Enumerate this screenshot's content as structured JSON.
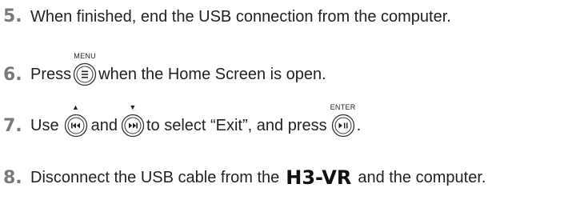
{
  "steps": [
    {
      "num": "5.",
      "text": "When finished, end the USB connection from the computer."
    },
    {
      "num": "6.",
      "pre": "Press",
      "button_caption": "MENU",
      "post": "when the Home Screen is open."
    },
    {
      "num": "7.",
      "pre": "Use",
      "mid1": "and",
      "mid2": "to select “Exit”, and press",
      "end": ".",
      "enter_caption": "ENTER"
    },
    {
      "num": "8.",
      "pre": "Disconnect the USB cable from the",
      "brand": "H3-VR",
      "post": "and the computer."
    }
  ],
  "icons": {
    "menu": "menu-button-icon",
    "prev": "rewind-button-icon",
    "next": "fast-forward-button-icon",
    "enter": "play-pause-button-icon",
    "up_marker": "up-triangle-icon",
    "down_marker": "down-triangle-icon"
  },
  "colors": {
    "step_number": "#7a7a7a",
    "text": "#222222"
  }
}
